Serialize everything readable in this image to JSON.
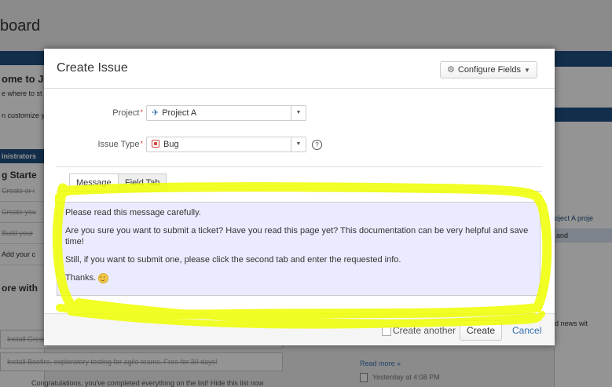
{
  "background": {
    "title_partial": "board",
    "left": {
      "welcome": "ome to JI",
      "where": "e where to st",
      "customize": "n customize y",
      "administrators": "inistrators",
      "getting_started": "g Starte",
      "items": [
        "Create or i",
        "Create you",
        "Build your",
        "Add your c"
      ],
      "more": "ore with"
    },
    "bottom_rows": [
      "Install Greenhopper",
      "Install Bonfire, exploratory testing for agile teams. Free for 30 days!"
    ],
    "congrats": "Congratulations, you've completed everything on the list! Hide this list now",
    "right": {
      "project_text": "oject A proje",
      "and_text": "and",
      "news_text": "d news wit"
    },
    "read_more": "Read more »",
    "yesterday": "Yesterday at 4:08 PM"
  },
  "dialog": {
    "title": "Create Issue",
    "configure_fields": "Configure Fields",
    "project": {
      "label": "Project",
      "required_mark": "*",
      "value": "Project A"
    },
    "issue_type": {
      "label": "Issue Type",
      "required_mark": "*",
      "value": "Bug",
      "help": "?"
    },
    "tabs": [
      {
        "label": "Message",
        "active": true
      },
      {
        "label": "Field Tab",
        "active": false
      }
    ],
    "message": {
      "lines": [
        "Please read this message carefully.",
        "Are you sure you want to submit a ticket? Have you read this page yet? This documentation can be very helpful and save time!",
        "Still, if you want to submit one, please click the second tab and enter the requested info.",
        "Thanks."
      ]
    },
    "footer": {
      "create_another": "Create another",
      "create_another_checked": false,
      "create": "Create",
      "cancel": "Cancel"
    }
  },
  "colors": {
    "brand_blue": "#205081",
    "link_blue": "#3572b0",
    "message_bg": "#ebebff",
    "highlight": "#f0ff00"
  },
  "icons": {
    "configure": "gear-icon",
    "dropdown": "chevron-down-icon",
    "project": "project-icon",
    "bug": "bug-icon",
    "help": "help-icon",
    "emoji": "smiley-icon"
  }
}
